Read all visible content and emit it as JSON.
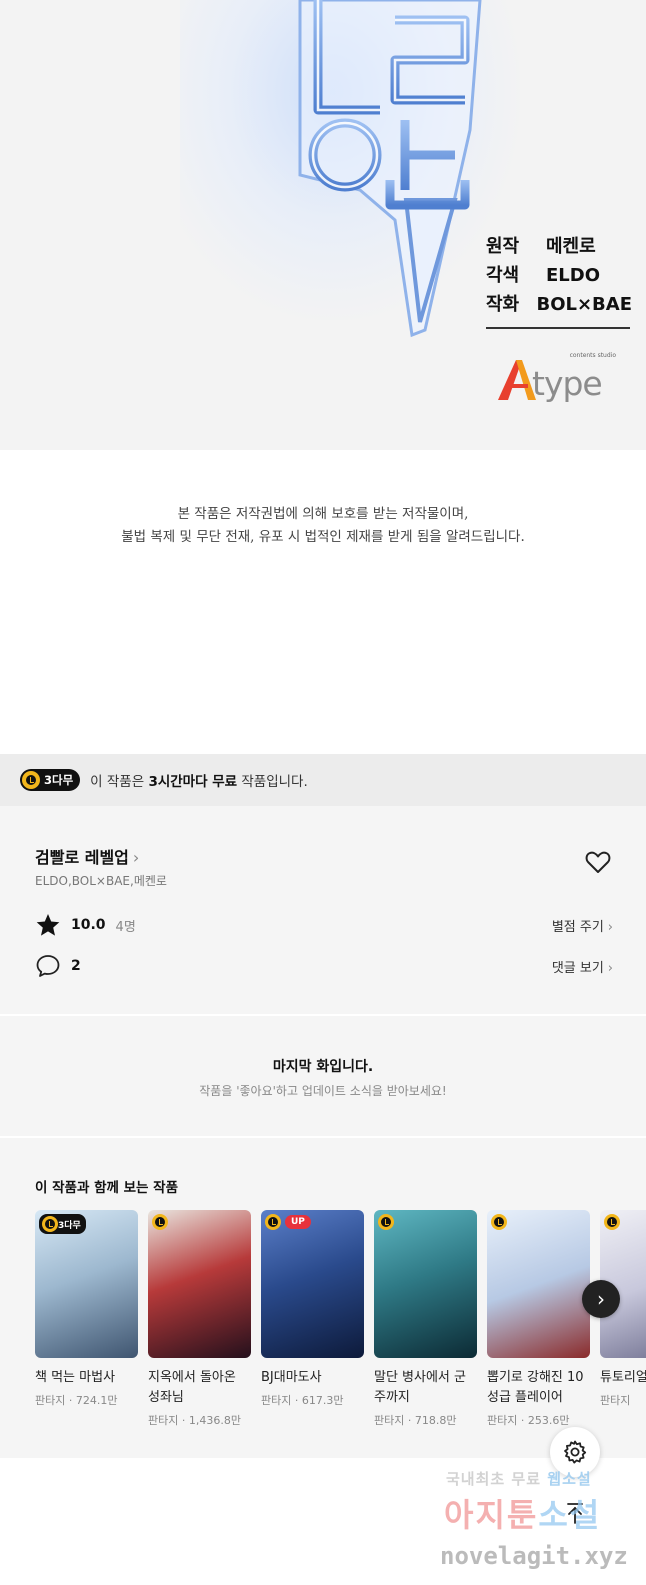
{
  "artwork": {
    "credits": [
      {
        "role": "원작",
        "name": "메켄로"
      },
      {
        "role": "각색",
        "name": "ELDO"
      },
      {
        "role": "작화",
        "name": "BOL×BAE"
      }
    ],
    "logo": {
      "small_text": "contents studio",
      "text": "type"
    }
  },
  "notice": {
    "line1": "본 작품은 저작권법에 의해 보호를 받는 저작물이며,",
    "line2": "불법 복제 및 무단 전재, 유포 시 법적인 제재를 받게 됨을 알려드립니다."
  },
  "free_banner": {
    "badge": "3다무",
    "prefix": "이 작품은 ",
    "bold": "3시간마다 무료",
    "suffix": " 작품입니다."
  },
  "series": {
    "title": "검빨로 레벨업",
    "authors": "ELDO,BOL×BAE,메켄로",
    "rating": "10.0",
    "rating_count": "4명",
    "rate_link": "별점 주기",
    "comment_count": "2",
    "comment_link": "댓글 보기"
  },
  "last_episode": {
    "title": "마지막 화입니다.",
    "subtitle": "작품을 '좋아요'하고 업데이트 소식을 받아보세요!"
  },
  "recommendations": {
    "heading": "이 작품과 함께 보는 작품",
    "items": [
      {
        "name": "책 먹는 마법사",
        "meta": "판타지 · 724.1만",
        "badge": "3다무",
        "cover_colors": [
          "#c9dff0",
          "#5a6f8a"
        ]
      },
      {
        "name": "지옥에서 돌아온 성좌님",
        "meta": "판타지 · 1,436.8만",
        "cover_colors": [
          "#c23a3a",
          "#2a1020"
        ]
      },
      {
        "name": "BJ대마도사",
        "meta": "판타지 · 617.3만",
        "badge": "UP",
        "cover_colors": [
          "#2a4a8c",
          "#0d1a3a"
        ]
      },
      {
        "name": "말단 병사에서 군주까지",
        "meta": "판타지 · 718.8만",
        "cover_colors": [
          "#2f7a86",
          "#0c2a34"
        ]
      },
      {
        "name": "뽑기로 강해진 10성급 플레이어",
        "meta": "판타지 · 253.6만",
        "cover_colors": [
          "#dbe8f8",
          "#8a2a2a"
        ]
      },
      {
        "name": "튜토리얼 어",
        "meta": "판타지",
        "cover_colors": [
          "#e8e8f0",
          "#6a6a8a"
        ]
      }
    ]
  },
  "watermark": {
    "line1_a": "국내최초 무료",
    "line1_b": "웹소설",
    "line2_a": "아지툰",
    "line2_b": "소설",
    "line3": "novelagit.xyz"
  },
  "colors": {
    "accent_yellow": "#f2b61c",
    "up_red": "#e8323c",
    "title_blue": "#7fa8e8"
  }
}
